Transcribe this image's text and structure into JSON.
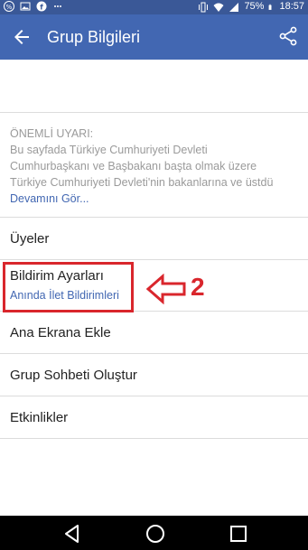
{
  "status_bar": {
    "battery": "75%",
    "time": "18:57"
  },
  "app_bar": {
    "title": "Grup Bilgileri"
  },
  "warning": {
    "title": "ÖNEMLİ UYARI:",
    "body_lines": [
      "Bu sayfada Türkiye Cumhuriyeti Devleti",
      "Cumhurbaşkanı ve Başbakanı başta olmak üzere",
      "Türkiye Cumhuriyeti Devleti'nin bakanlarına ve üstdü"
    ],
    "more_link": "Devamını Gör..."
  },
  "menu": {
    "members": "Üyeler",
    "notif_settings": "Bildirim Ayarları",
    "notif_settings_value": "Anında İlet Bildirimleri",
    "add_home": "Ana Ekrana Ekle",
    "create_chat": "Grup Sohbeti Oluştur",
    "events": "Etkinlikler"
  },
  "annotation": {
    "step_number": "2",
    "color": "#d9262c"
  },
  "colors": {
    "appbar": "#4267b2",
    "statusbar": "#3a5897",
    "link": "#4267b2"
  }
}
